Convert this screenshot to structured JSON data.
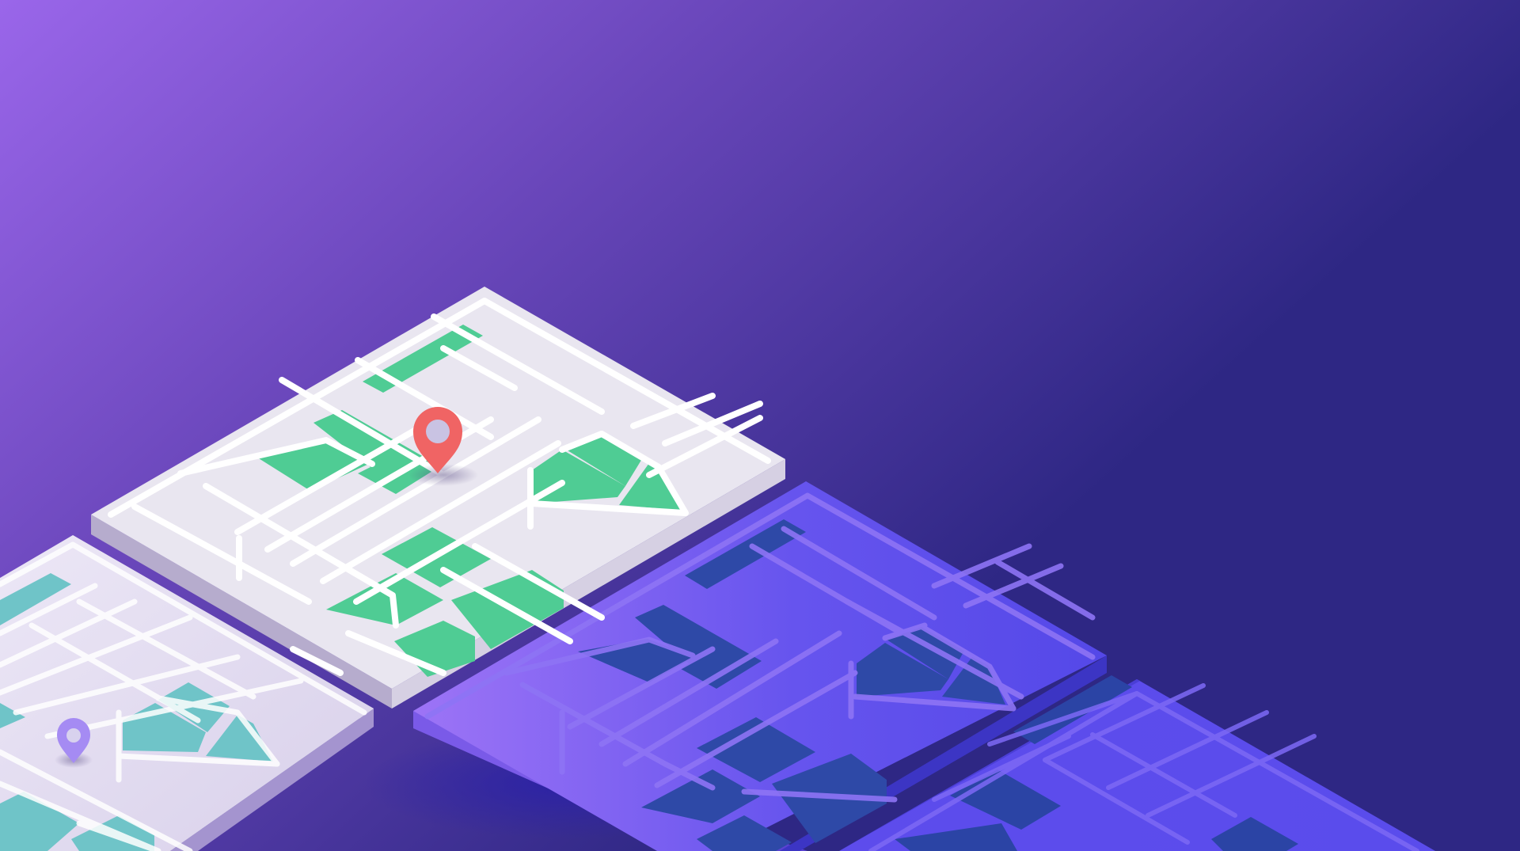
{
  "colors": {
    "background_top_left": "#9a66ea",
    "background_bottom_right": "#2e2784",
    "map_light_surface": "#e8e4ef",
    "map_light_side": "#b9afcc",
    "map_street": "#ffffff",
    "park_green": "#4fcc94",
    "park_teal": "#6cc4c4",
    "map_dark_surface": "#6b55ee",
    "map_dark_block": "#2f4aa8",
    "pin_red": "#f06464",
    "pin_purple": "#a58bf3",
    "pin_center": "#c9c3e3"
  },
  "icons": {
    "primary_pin": "map-pin-icon",
    "secondary_pin": "map-pin-icon"
  }
}
